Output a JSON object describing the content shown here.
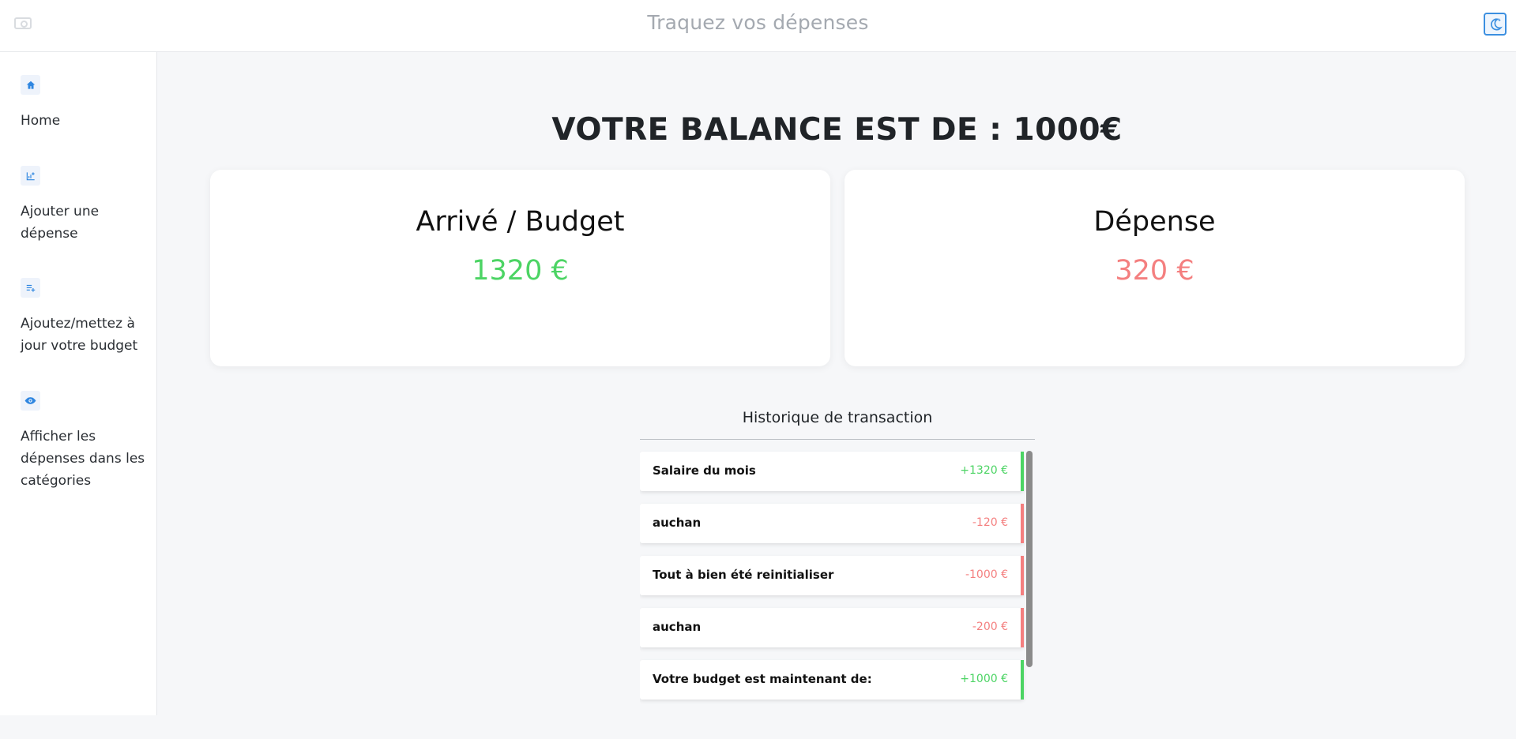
{
  "header": {
    "title": "Traquez vos dépenses",
    "logo_icon": "wallet-icon",
    "theme_icon": "moon-stars-icon"
  },
  "sidebar": {
    "items": [
      {
        "label": "Home",
        "icon": "home-icon"
      },
      {
        "label": "Ajouter une dépense",
        "icon": "chart-add-icon"
      },
      {
        "label": "Ajoutez/mettez à jour votre budget",
        "icon": "playlist-add-icon"
      },
      {
        "label": "Afficher les dépenses dans les catégories",
        "icon": "eye-icon"
      }
    ]
  },
  "main": {
    "balance": "VOTRE BALANCE EST DE : 1000€",
    "cards": [
      {
        "title": "Arrivé / Budget",
        "value": "1320 €",
        "color": "#4cd464"
      },
      {
        "title": "Dépense",
        "value": "320 €",
        "color": "#f47f7f"
      }
    ],
    "history": {
      "title": "Historique de transaction",
      "transactions": [
        {
          "name": "Salaire du mois",
          "amount": "+1320 €",
          "type": "income"
        },
        {
          "name": "auchan",
          "amount": "-120 €",
          "type": "expense"
        },
        {
          "name": "Tout à bien été reinitialiser",
          "amount": "-1000 €",
          "type": "expense"
        },
        {
          "name": "auchan",
          "amount": "-200 €",
          "type": "expense"
        },
        {
          "name": "Votre budget est maintenant de:",
          "amount": "+1000 €",
          "type": "income"
        }
      ]
    }
  },
  "colors": {
    "income": "#4cd464",
    "expense": "#f47f7f",
    "accent": "#3b8fe0"
  }
}
